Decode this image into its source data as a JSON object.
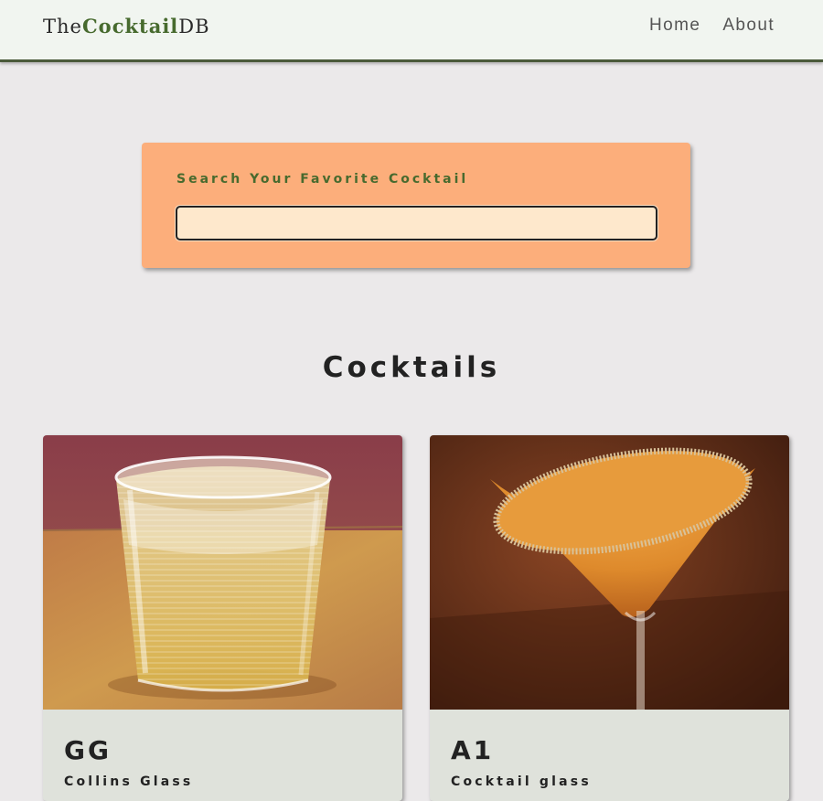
{
  "navbar": {
    "logo": {
      "pre": "The",
      "mid": "Cocktail",
      "post": "DB"
    },
    "links": [
      {
        "label": "Home"
      },
      {
        "label": "About"
      }
    ]
  },
  "search": {
    "label": "Search Your Favorite Cocktail",
    "value": "",
    "placeholder": ""
  },
  "section": {
    "title": "Cocktails"
  },
  "cocktails": [
    {
      "name": "GG",
      "glass": "Collins Glass",
      "image": "glass-tumbler-drink-photo"
    },
    {
      "name": "A1",
      "glass": "Cocktail glass",
      "image": "martini-glass-drink-photo"
    }
  ],
  "colors": {
    "navbar_bg": "#f1f5f0",
    "accent_green": "#476a2e",
    "search_card": "#fcae7b",
    "search_input": "#fee8cc",
    "page_bg": "#ebe9ea",
    "card_footer": "#dfe2db"
  }
}
